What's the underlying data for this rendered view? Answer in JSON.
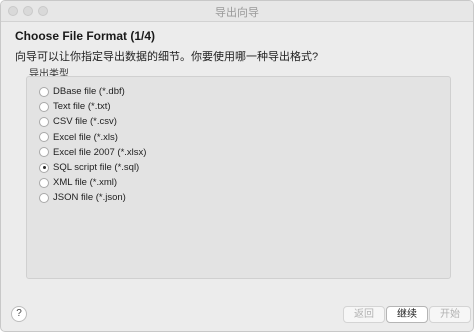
{
  "window": {
    "title": "导出向导"
  },
  "header": {
    "heading": "Choose File Format (1/4)",
    "subtitle": "向导可以让你指定导出数据的细节。你要使用哪一种导出格式?"
  },
  "format_group": {
    "label": "导出类型",
    "options": [
      {
        "label": "DBase file (*.dbf)",
        "selected": false
      },
      {
        "label": "Text file (*.txt)",
        "selected": false
      },
      {
        "label": "CSV file (*.csv)",
        "selected": false
      },
      {
        "label": "Excel file (*.xls)",
        "selected": false
      },
      {
        "label": "Excel file 2007 (*.xlsx)",
        "selected": false
      },
      {
        "label": "SQL script file (*.sql)",
        "selected": true
      },
      {
        "label": "XML file (*.xml)",
        "selected": false
      },
      {
        "label": "JSON file (*.json)",
        "selected": false
      }
    ]
  },
  "footer": {
    "help_label": "?",
    "back_label": "返回",
    "next_label": "继续",
    "start_label": "开始"
  }
}
